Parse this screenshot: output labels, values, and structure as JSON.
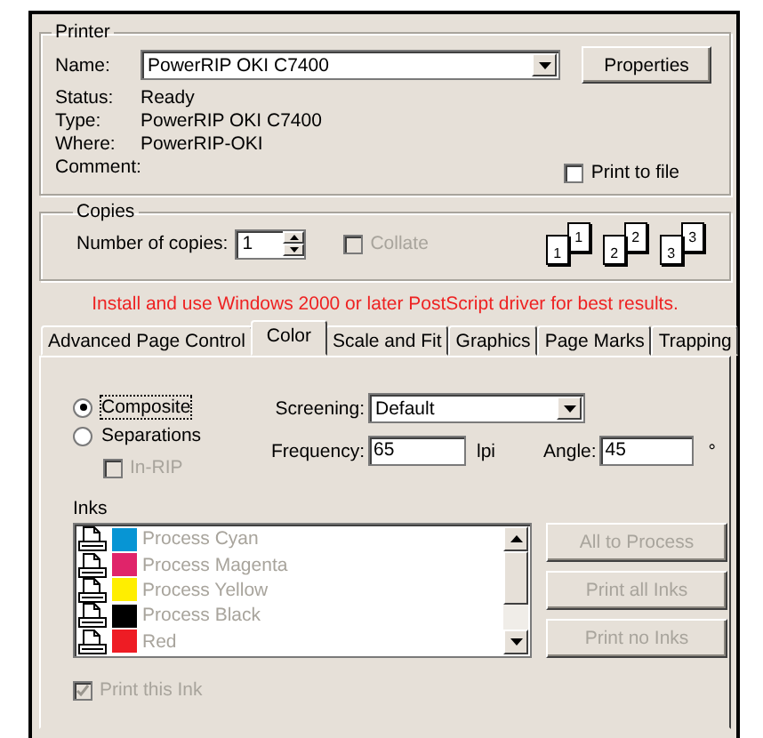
{
  "printer": {
    "title": "Printer",
    "name_label": "Name:",
    "name_value": "PowerRIP OKI C7400",
    "properties_button": "Properties",
    "info": [
      {
        "label": "Status:",
        "value": "Ready"
      },
      {
        "label": "Type:",
        "value": "PowerRIP OKI C7400"
      },
      {
        "label": "Where:",
        "value": "PowerRIP-OKI"
      },
      {
        "label": "Comment:"
      }
    ],
    "print_to_file": {
      "label": "Print to file",
      "checked": false
    }
  },
  "copies": {
    "title": "Copies",
    "label": "Number of copies:",
    "value": "1",
    "collate": {
      "label": "Collate",
      "checked": false,
      "disabled": true
    },
    "pages": [
      {
        "front": "1",
        "back": "1"
      },
      {
        "front": "2",
        "back": "2"
      },
      {
        "front": "3",
        "back": "3"
      }
    ]
  },
  "warning": "Install and use Windows 2000 or later PostScript driver for best results.",
  "tabs": [
    {
      "label": "Advanced Page Control",
      "selected": false
    },
    {
      "label": "Color",
      "selected": true
    },
    {
      "label": "Scale and Fit",
      "selected": false
    },
    {
      "label": "Graphics",
      "selected": false
    },
    {
      "label": "Page Marks",
      "selected": false
    },
    {
      "label": "Trapping",
      "selected": false
    }
  ],
  "color": {
    "modes": [
      {
        "label": "Composite",
        "selected": true
      },
      {
        "label": "Separations",
        "selected": false
      }
    ],
    "in_rip": {
      "label": "In-RIP",
      "checked": false,
      "disabled": true
    },
    "screening": {
      "label": "Screening:",
      "value": "Default"
    },
    "frequency": {
      "label": "Frequency:",
      "value": "65",
      "unit": "lpi"
    },
    "angle": {
      "label": "Angle:",
      "value": "45",
      "unit": "°"
    },
    "inks_label": "Inks",
    "inks": [
      {
        "name": "Process Cyan",
        "color": "#0795d4"
      },
      {
        "name": "Process Magenta",
        "color": "#e0246a"
      },
      {
        "name": "Process Yellow",
        "color": "#ffee00"
      },
      {
        "name": "Process Black",
        "color": "#000000"
      },
      {
        "name": "Red",
        "color": "#ee1c24"
      }
    ],
    "ink_buttons": [
      {
        "label": "All to Process",
        "disabled": true
      },
      {
        "label": "Print all Inks",
        "disabled": true
      },
      {
        "label": "Print no Inks",
        "disabled": true
      }
    ],
    "print_this_ink": {
      "label": "Print this Ink",
      "checked": true,
      "disabled": true
    }
  }
}
